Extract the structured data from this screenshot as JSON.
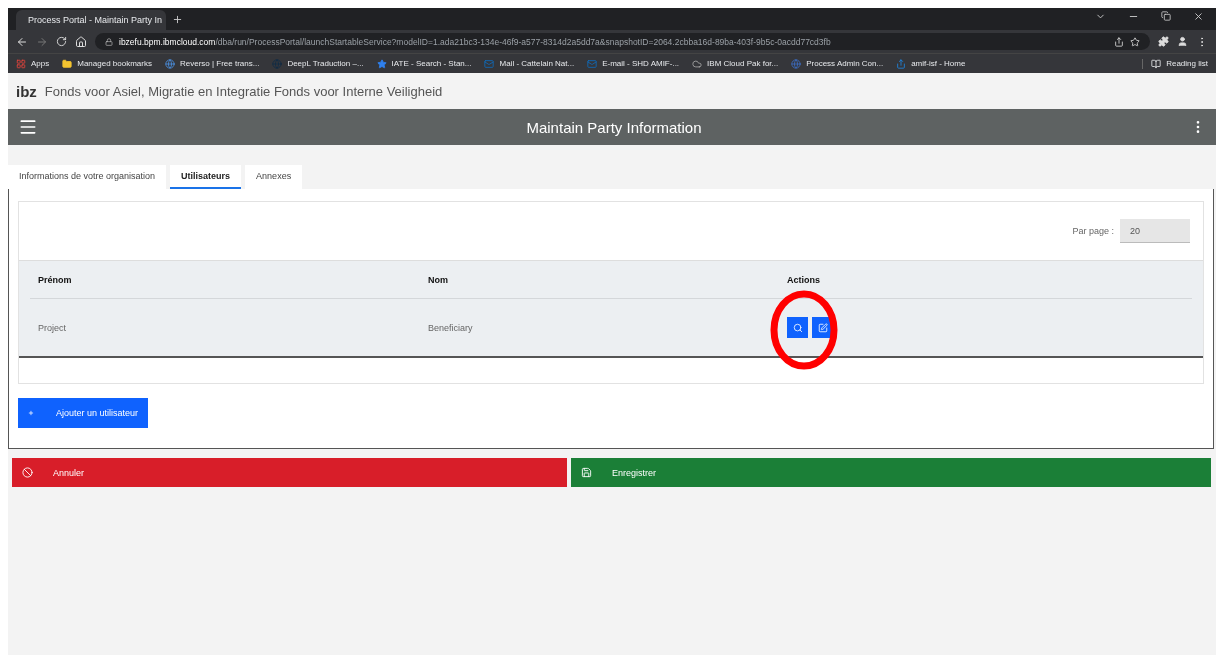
{
  "browser": {
    "tabs": [
      {
        "title": "Process Portal - Maintain Party In",
        "selected": true
      }
    ],
    "url_host": "ibzefu.bpm.ibmcloud.com",
    "url_path": "/dba/run/ProcessPortal/launchStartableService?modelID=1.ada21bc3-134e-46f9-a577-8314d2a5dd7a&snapshotID=2064.2cbba16d-89ba-403f-9b5c-0acdd77cd3fb",
    "bookmarks": [
      {
        "label": "Apps",
        "kind": "apps"
      },
      {
        "label": "Managed bookmarks",
        "kind": "folder"
      },
      {
        "label": "Reverso | Free trans...",
        "kind": "reverso"
      },
      {
        "label": "DeepL Traduction –...",
        "kind": "deepl"
      },
      {
        "label": "IATE - Search - Stan...",
        "kind": "star"
      },
      {
        "label": "Mail - Cattelain Nat...",
        "kind": "outlook"
      },
      {
        "label": "E-mail - SHD AMIF-...",
        "kind": "outlook"
      },
      {
        "label": "IBM Cloud Pak for...",
        "kind": "cloud"
      },
      {
        "label": "Process Admin Con...",
        "kind": "globe"
      },
      {
        "label": "amif-isf - Home",
        "kind": "sharepoint"
      }
    ],
    "reading_list": "Reading list"
  },
  "app": {
    "logo": "ibz",
    "org_title": "Fonds voor Asiel, Migratie en Integratie Fonds voor Interne Veiligheid",
    "page_title": "Maintain Party Information"
  },
  "tabs": [
    {
      "label": "Informations de votre organisation",
      "selected": false
    },
    {
      "label": "Utilisateurs",
      "selected": true
    },
    {
      "label": "Annexes",
      "selected": false
    }
  ],
  "per_page": {
    "label": "Par page :",
    "value": "20"
  },
  "table": {
    "columns": [
      "Prénom",
      "Nom",
      "Actions"
    ],
    "rows": [
      {
        "cells": [
          "Project",
          "Beneficiary"
        ]
      }
    ]
  },
  "add_button": "Ajouter un utilisateur",
  "cancel_button": "Annuler",
  "save_button": "Enregistrer"
}
